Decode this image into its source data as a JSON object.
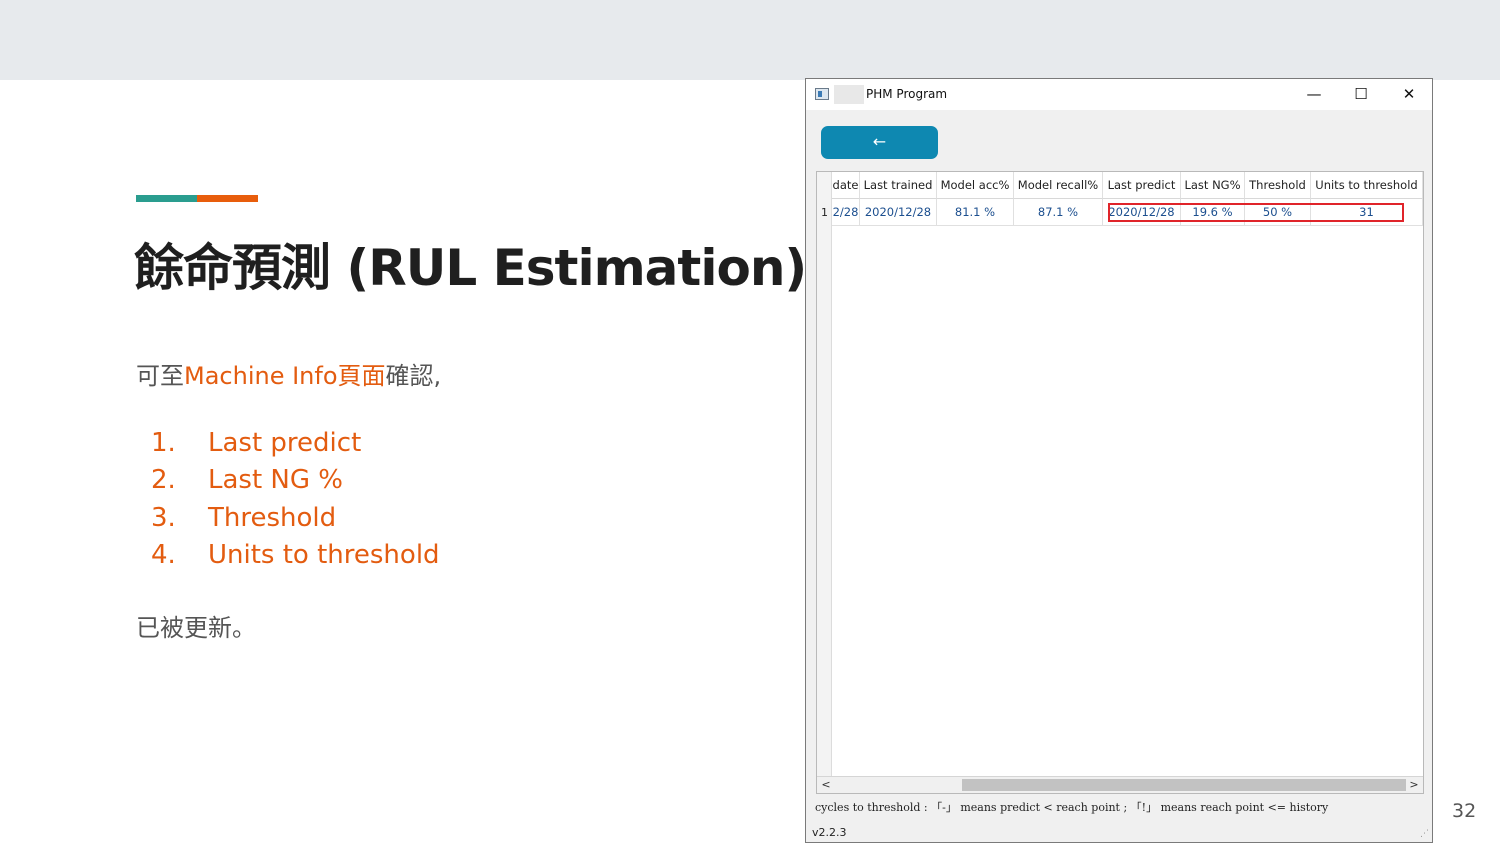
{
  "slide": {
    "title": "餘命預測 (RUL Estimation)",
    "intro_prefix": "可至",
    "intro_highlight": "Machine Info頁面",
    "intro_suffix": "確認,",
    "items": [
      {
        "num": "1.",
        "label": "Last predict"
      },
      {
        "num": "2.",
        "label": "Last NG %"
      },
      {
        "num": "3.",
        "label": "Threshold"
      },
      {
        "num": "4.",
        "label": "Units to threshold"
      }
    ],
    "outro": "已被更新。",
    "page_number": "32",
    "colors": {
      "accent_teal": "#2a9d8f",
      "accent_orange": "#e85d0c",
      "highlight_text": "#e35c10"
    }
  },
  "window": {
    "title": "PHM Program",
    "controls": {
      "minimize": "—",
      "maximize": "☐",
      "close": "✕"
    },
    "back_button": "←",
    "columns": [
      "date",
      "Last trained",
      "Model acc%",
      "Model recall%",
      "Last predict",
      "Last NG%",
      "Threshold",
      "Units to threshold"
    ],
    "rows": [
      {
        "index": "1",
        "cells": [
          "2/28",
          "2020/12/28",
          "81.1 %",
          "87.1 %",
          "2020/12/28",
          "19.6 %",
          "50 %",
          "31"
        ]
      }
    ],
    "scroll": {
      "left": "<",
      "right": ">"
    },
    "legend": "cycles to threshold : 「-」 means predict < reach point ; 「!」 means reach point <= history",
    "version": "v2.2.3",
    "grip": "⋰"
  }
}
